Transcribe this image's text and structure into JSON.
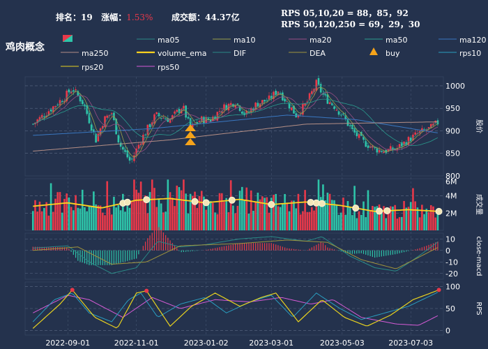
{
  "header": {
    "rank_label": "排名：",
    "rank_value": "19",
    "change_label": "涨幅：",
    "change_value": "1.53%",
    "turnover_label": "成交额：",
    "turnover_value": "44.37亿",
    "rps_short": "RPS 05,10,20 = 88，85，92",
    "rps_long": "RPS 50,120,250 = 69，29，30"
  },
  "sector_name": "鸡肉概念",
  "legend": [
    {
      "key": "candle",
      "label": "",
      "color": "#e8394a",
      "color2": "#2ec4a9"
    },
    {
      "key": "ma05",
      "label": "ma05",
      "color": "#2a8a86"
    },
    {
      "key": "ma10",
      "label": "ma10",
      "color": "#9aa04a"
    },
    {
      "key": "ma20",
      "label": "ma20",
      "color": "#9b4f86"
    },
    {
      "key": "ma50",
      "label": "ma50",
      "color": "#2a9d8f"
    },
    {
      "key": "ma120",
      "label": "ma120",
      "color": "#3a78c2"
    },
    {
      "key": "ma250",
      "label": "ma250",
      "color": "#b58f86"
    },
    {
      "key": "volume_ema",
      "label": "volume_ema",
      "color": "#ffd21f"
    },
    {
      "key": "DIF",
      "label": "DIF",
      "color": "#2a8a86"
    },
    {
      "key": "DEA",
      "label": "DEA",
      "color": "#a0943d"
    },
    {
      "key": "buy",
      "label": "buy",
      "color": "#f5a31a"
    },
    {
      "key": "rps10",
      "label": "rps10",
      "color": "#2a9ec0"
    },
    {
      "key": "rps20",
      "label": "rps20",
      "color": "#e8d21f"
    },
    {
      "key": "rps50",
      "label": "rps50",
      "color": "#d65bd6"
    }
  ],
  "chart_data": {
    "type": "candlestick_multi_panel",
    "x_tick_labels": [
      "2022-09-01",
      "2022-11-01",
      "2023-01-02",
      "2023-03-01",
      "2023-05-03",
      "2023-07-03"
    ],
    "panels": [
      {
        "name": "price",
        "ylabel": "股价",
        "yticks": [
          800,
          850,
          900,
          950,
          1000
        ],
        "ylim": [
          800,
          1020
        ],
        "close_path": [
          [
            "2022-08-01",
            915
          ],
          [
            "2022-08-15",
            945
          ],
          [
            "2022-08-29",
            975
          ],
          [
            "2022-09-05",
            995
          ],
          [
            "2022-09-15",
            960
          ],
          [
            "2022-09-26",
            880
          ],
          [
            "2022-10-03",
            925
          ],
          [
            "2022-10-10",
            940
          ],
          [
            "2022-10-17",
            870
          ],
          [
            "2022-10-27",
            830
          ],
          [
            "2022-11-05",
            880
          ],
          [
            "2022-11-18",
            935
          ],
          [
            "2022-12-01",
            925
          ],
          [
            "2022-12-12",
            955
          ],
          [
            "2022-12-19",
            905
          ],
          [
            "2022-12-28",
            925
          ],
          [
            "2023-01-06",
            925
          ],
          [
            "2023-01-16",
            950
          ],
          [
            "2023-01-28",
            965
          ],
          [
            "2023-02-06",
            935
          ],
          [
            "2023-02-16",
            960
          ],
          [
            "2023-02-27",
            970
          ],
          [
            "2023-03-07",
            990
          ],
          [
            "2023-03-16",
            960
          ],
          [
            "2023-03-23",
            935
          ],
          [
            "2023-04-01",
            960
          ],
          [
            "2023-04-10",
            1005
          ],
          [
            "2023-04-17",
            975
          ],
          [
            "2023-04-26",
            955
          ],
          [
            "2023-05-03",
            935
          ],
          [
            "2023-05-12",
            900
          ],
          [
            "2023-05-22",
            875
          ],
          [
            "2023-06-01",
            860
          ],
          [
            "2023-06-10",
            855
          ],
          [
            "2023-06-20",
            860
          ],
          [
            "2023-07-01",
            880
          ],
          [
            "2023-07-10",
            895
          ],
          [
            "2023-07-20",
            905
          ],
          [
            "2023-07-28",
            920
          ]
        ],
        "ma_paths": {
          "ma250": [
            [
              "2022-08-01",
              855
            ],
            [
              "2022-12-01",
              880
            ],
            [
              "2023-04-01",
              915
            ],
            [
              "2023-07-28",
              920
            ]
          ],
          "ma120": [
            [
              "2022-08-01",
              890
            ],
            [
              "2022-11-15",
              905
            ],
            [
              "2023-03-15",
              935
            ],
            [
              "2023-05-15",
              925
            ],
            [
              "2023-07-28",
              895
            ]
          ]
        },
        "buy_signals": [
          {
            "date": "2022-12-19",
            "count": 3
          }
        ]
      },
      {
        "name": "volume",
        "ylabel": "成交量",
        "yticks_labels": [
          "2M",
          "4M",
          "6M"
        ],
        "yticks": [
          2,
          4,
          6
        ],
        "ylim": [
          0,
          6
        ],
        "unit": "M",
        "volume_ema_path": [
          [
            "2022-08-01",
            2.8
          ],
          [
            "2022-09-01",
            3.2
          ],
          [
            "2022-10-01",
            2.6
          ],
          [
            "2022-11-01",
            3.5
          ],
          [
            "2022-12-01",
            3.7
          ],
          [
            "2023-01-01",
            3.2
          ],
          [
            "2023-02-01",
            3.6
          ],
          [
            "2023-03-01",
            3.0
          ],
          [
            "2023-04-01",
            3.3
          ],
          [
            "2023-05-01",
            2.9
          ],
          [
            "2023-06-01",
            2.2
          ],
          [
            "2023-07-01",
            2.4
          ],
          [
            "2023-07-28",
            2.2
          ]
        ],
        "markers": [
          "2022-10-20",
          "2022-10-24",
          "2022-11-10",
          "2022-12-23",
          "2023-01-02",
          "2023-01-25",
          "2023-03-01",
          "2023-04-05",
          "2023-04-10",
          "2023-04-15",
          "2023-05-15",
          "2023-06-05",
          "2023-06-12",
          "2023-07-28"
        ]
      },
      {
        "name": "macd",
        "ylabel": "close-macd",
        "yticks": [
          -20,
          -10,
          0,
          10
        ],
        "ylim": [
          -25,
          15
        ],
        "dif_path": [
          [
            "2022-08-01",
            2
          ],
          [
            "2022-09-01",
            4
          ],
          [
            "2022-09-20",
            -10
          ],
          [
            "2022-10-10",
            -20
          ],
          [
            "2022-11-01",
            -15
          ],
          [
            "2022-11-20",
            8
          ],
          [
            "2022-12-10",
            3
          ],
          [
            "2023-01-01",
            5
          ],
          [
            "2023-02-01",
            10
          ],
          [
            "2023-03-01",
            12
          ],
          [
            "2023-04-01",
            8
          ],
          [
            "2023-04-15",
            12
          ],
          [
            "2023-05-10",
            -5
          ],
          [
            "2023-06-01",
            -15
          ],
          [
            "2023-06-20",
            -18
          ],
          [
            "2023-07-10",
            -5
          ],
          [
            "2023-07-28",
            8
          ]
        ],
        "dea_path": [
          [
            "2022-08-01",
            0
          ],
          [
            "2022-09-10",
            3
          ],
          [
            "2022-10-10",
            -12
          ],
          [
            "2022-11-10",
            -10
          ],
          [
            "2022-12-10",
            4
          ],
          [
            "2023-02-01",
            6
          ],
          [
            "2023-03-15",
            9
          ],
          [
            "2023-04-20",
            7
          ],
          [
            "2023-05-20",
            -8
          ],
          [
            "2023-06-20",
            -16
          ],
          [
            "2023-07-28",
            3
          ]
        ]
      },
      {
        "name": "rps",
        "ylabel": "RPS",
        "yticks": [
          0,
          50,
          100
        ],
        "ylim": [
          -10,
          110
        ],
        "rps10_path": [
          [
            "2022-08-01",
            20
          ],
          [
            "2022-08-20",
            70
          ],
          [
            "2022-09-05",
            85
          ],
          [
            "2022-09-20",
            40
          ],
          [
            "2022-10-10",
            20
          ],
          [
            "2022-10-25",
            70
          ],
          [
            "2022-11-05",
            85
          ],
          [
            "2022-11-20",
            30
          ],
          [
            "2022-12-10",
            60
          ],
          [
            "2023-01-01",
            75
          ],
          [
            "2023-01-20",
            40
          ],
          [
            "2023-02-10",
            65
          ],
          [
            "2023-03-01",
            80
          ],
          [
            "2023-03-20",
            30
          ],
          [
            "2023-04-10",
            85
          ],
          [
            "2023-05-01",
            50
          ],
          [
            "2023-05-20",
            25
          ],
          [
            "2023-06-10",
            40
          ],
          [
            "2023-07-01",
            55
          ],
          [
            "2023-07-28",
            88
          ]
        ],
        "rps20_path": [
          [
            "2022-08-01",
            5
          ],
          [
            "2022-08-25",
            60
          ],
          [
            "2022-09-05",
            92
          ],
          [
            "2022-09-25",
            30
          ],
          [
            "2022-10-15",
            5
          ],
          [
            "2022-11-01",
            85
          ],
          [
            "2022-11-10",
            90
          ],
          [
            "2022-12-01",
            10
          ],
          [
            "2022-12-20",
            55
          ],
          [
            "2023-01-10",
            85
          ],
          [
            "2023-02-01",
            55
          ],
          [
            "2023-02-20",
            75
          ],
          [
            "2023-03-05",
            85
          ],
          [
            "2023-03-25",
            20
          ],
          [
            "2023-04-15",
            70
          ],
          [
            "2023-05-05",
            30
          ],
          [
            "2023-05-25",
            10
          ],
          [
            "2023-06-15",
            35
          ],
          [
            "2023-07-05",
            70
          ],
          [
            "2023-07-28",
            92
          ]
        ],
        "rps50_path": [
          [
            "2022-08-01",
            40
          ],
          [
            "2022-09-01",
            80
          ],
          [
            "2022-09-20",
            70
          ],
          [
            "2022-10-20",
            30
          ],
          [
            "2022-11-15",
            75
          ],
          [
            "2022-12-10",
            50
          ],
          [
            "2023-01-10",
            70
          ],
          [
            "2023-02-10",
            65
          ],
          [
            "2023-03-10",
            75
          ],
          [
            "2023-04-05",
            60
          ],
          [
            "2023-04-25",
            70
          ],
          [
            "2023-05-20",
            30
          ],
          [
            "2023-06-20",
            15
          ],
          [
            "2023-07-10",
            12
          ],
          [
            "2023-07-28",
            35
          ]
        ],
        "peak_markers": [
          "2022-09-05",
          "2022-11-10",
          "2023-07-28"
        ]
      }
    ]
  }
}
